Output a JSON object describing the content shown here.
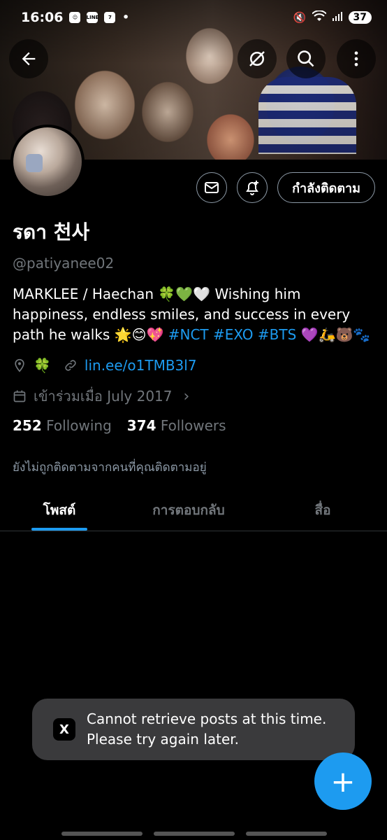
{
  "status_bar": {
    "time": "16:06",
    "battery": "37"
  },
  "header": {
    "back_icon": "arrow-left-icon",
    "hide_icon": "eye-slash-icon",
    "search_icon": "search-icon",
    "more_icon": "more-vertical-icon"
  },
  "profile": {
    "display_name": "รดา 천사",
    "handle": "@patiyanee02",
    "bio_text": "MARKLEE / Haechan 🍀💚🤍 Wishing him happiness, endless smiles, and success in every path he walks 🌟😊💖",
    "bio_tags": [
      "#NCT",
      "#EXO",
      "#BTS"
    ],
    "bio_tail": "💜🛵🐻🐾",
    "location": "🍀",
    "link": "lin.ee/o1TMB3l7",
    "joined": "เข้าร่วมเมื่อ July 2017",
    "following_count": "252",
    "following_label": "Following",
    "followers_count": "374",
    "followers_label": "Followers",
    "not_followed_note": "ยังไม่ถูกติดตามจากคนที่คุณติดตามอยู่"
  },
  "actions": {
    "message_icon": "mail-icon",
    "notify_icon": "bell-plus-icon",
    "follow_label": "กำลังติดตาม"
  },
  "tabs": [
    {
      "label": "โพสต์",
      "active": true
    },
    {
      "label": "การตอบกลับ",
      "active": false
    },
    {
      "label": "สื่อ",
      "active": false
    }
  ],
  "toast": {
    "logo": "X",
    "message": "Cannot retrieve posts at this time. Please try again later."
  },
  "fab": {
    "label": "+"
  }
}
